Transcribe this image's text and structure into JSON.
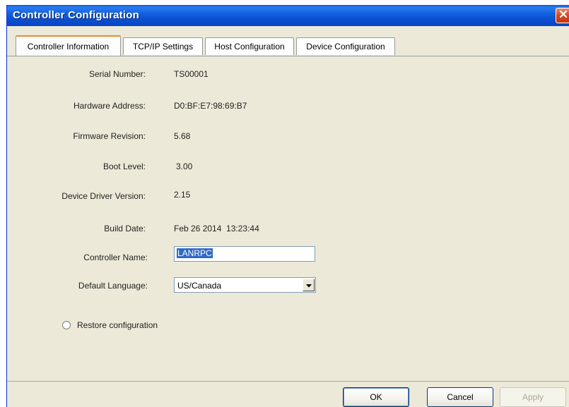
{
  "window": {
    "title": "Controller Configuration"
  },
  "tabs": [
    {
      "label": "Controller Information",
      "active": true
    },
    {
      "label": "TCP/IP Settings",
      "active": false
    },
    {
      "label": "Host Configuration",
      "active": false
    },
    {
      "label": "Device Configuration",
      "active": false
    }
  ],
  "controller_info": {
    "serial_number": {
      "label": "Serial Number:",
      "value": "TS00001"
    },
    "hardware_address": {
      "label": "Hardware Address:",
      "value": "D0:BF:E7:98:69:B7"
    },
    "firmware_revision": {
      "label": "Firmware Revision:",
      "value": "5.68"
    },
    "boot_level": {
      "label": "Boot Level:",
      "value": "3.00"
    },
    "device_driver_version": {
      "label": "Device Driver Version:",
      "value": "2.15"
    },
    "build_date": {
      "label": "Build Date:",
      "value": "Feb 26 2014  13:23:44"
    },
    "controller_name": {
      "label": "Controller Name:",
      "value": "LANRPC"
    },
    "default_language": {
      "label": "Default Language:",
      "value": "US/Canada"
    },
    "restore": {
      "label": "Restore configuration",
      "checked": false
    }
  },
  "buttons": {
    "ok": "OK",
    "cancel": "Cancel",
    "apply": "Apply"
  },
  "colors": {
    "titlebar": "#0a4fd0",
    "active_tab_accent": "#e68b2c",
    "selection": "#316ac5",
    "close_button": "#d6451c"
  },
  "icons": {
    "close": "close-icon",
    "dropdown": "chevron-down-icon"
  }
}
